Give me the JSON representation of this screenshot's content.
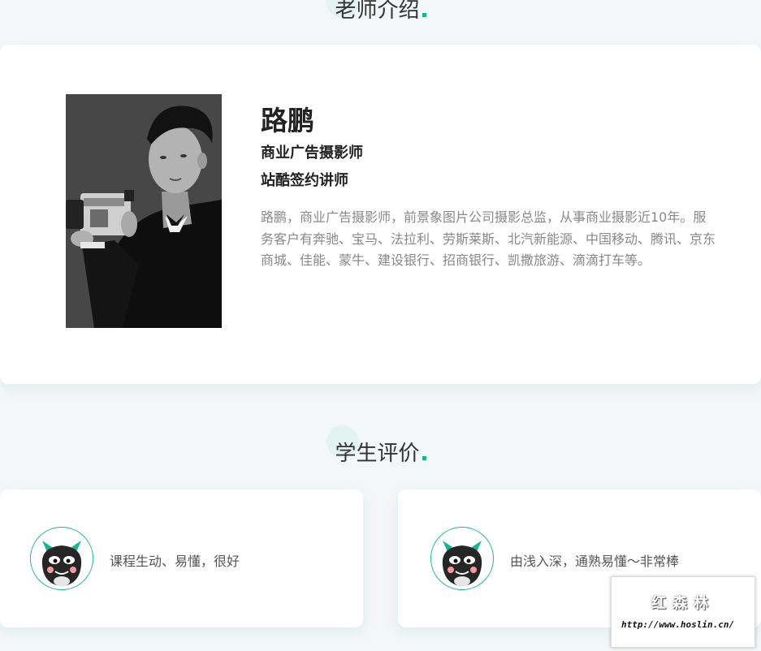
{
  "sections": {
    "teacher_title": "老师介绍",
    "review_title": "学生评价"
  },
  "teacher": {
    "name": "路鹏",
    "role": "商业广告摄影师",
    "role2": "站酷签约讲师",
    "bio": "路鹏，商业广告摄影师，前景象图片公司摄影总监，从事商业摄影近10年。服务客户有奔驰、宝马、法拉利、劳斯莱斯、北汽新能源、中国移动、腾讯、京东商城、佳能、蒙牛、建设银行、招商银行、凯撒旅游、滴滴打车等。",
    "photo_icon": "teacher-photo"
  },
  "reviews": [
    {
      "text": "课程生动、易懂，很好",
      "avatar_icon": "dragon-avatar-icon"
    },
    {
      "text": "由浅入深，通熟易懂～非常棒",
      "avatar_icon": "dragon-avatar-icon"
    }
  ],
  "watermark": {
    "brand": "红森林",
    "url": "http://www.hoslin.cn/"
  },
  "colors": {
    "accent": "#1bb394",
    "bubble": "#e2f3f1",
    "background": "#f4f7f7"
  }
}
